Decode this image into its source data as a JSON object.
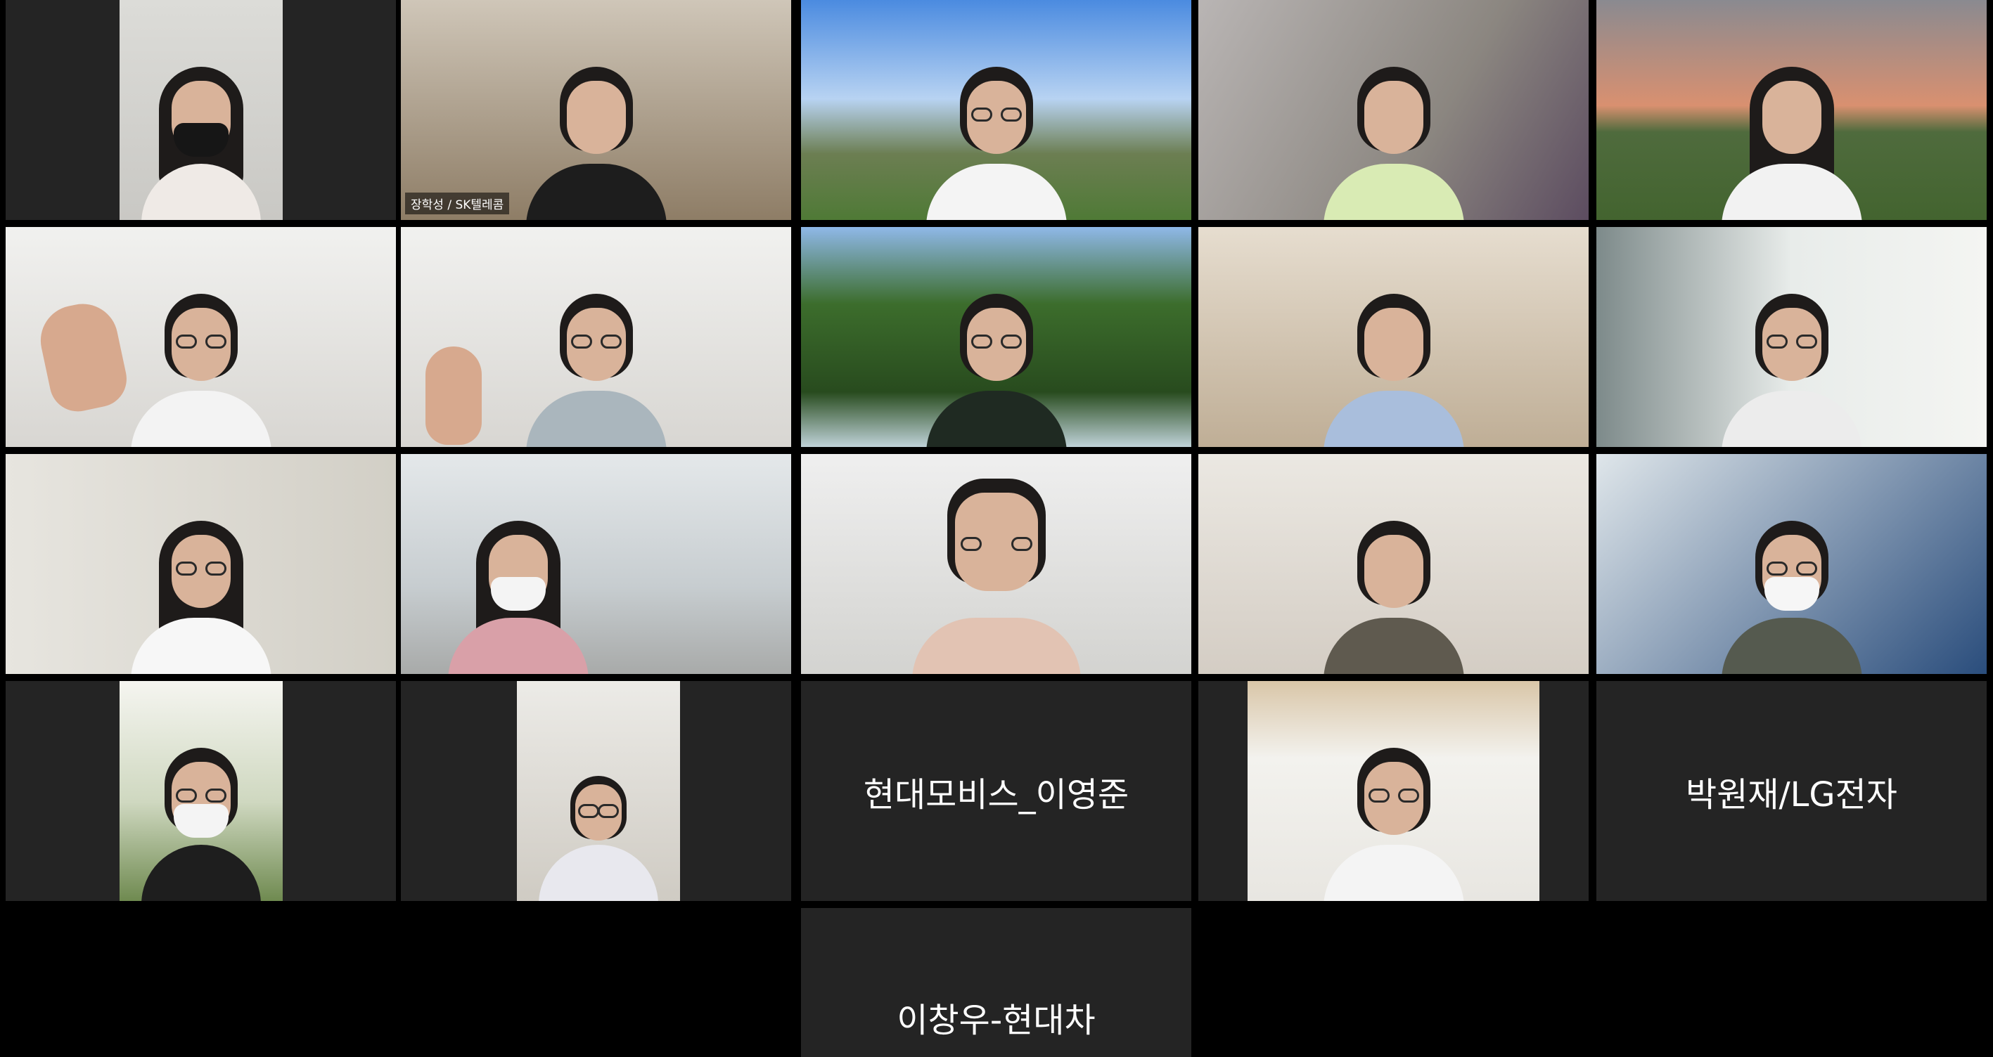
{
  "meeting": {
    "gallery": [
      {
        "id": "p1",
        "name_label": "",
        "bg": "bg-office",
        "framing": "narrow",
        "body": "#efeae6",
        "hair": "long",
        "glasses": false,
        "mask": "#161616",
        "active": false
      },
      {
        "id": "p2",
        "name_label": "장학성 / SK텔레콤",
        "bg": "bg-room",
        "framing": "full",
        "body": "#1d1d1d",
        "hair": "short",
        "glasses": false,
        "mask": "",
        "active": true
      },
      {
        "id": "p3",
        "name_label": "",
        "bg": "bg-sky",
        "framing": "full",
        "body": "#f4f4f4",
        "hair": "short",
        "glasses": true,
        "mask": "",
        "active": false
      },
      {
        "id": "p4",
        "name_label": "",
        "bg": "bg-blur",
        "framing": "full",
        "body": "#d9ebb4",
        "hair": "short",
        "glasses": false,
        "mask": "",
        "active": false
      },
      {
        "id": "p5",
        "name_label": "",
        "bg": "bg-sunset",
        "framing": "full",
        "body": "#f2f2f2",
        "hair": "long",
        "glasses": false,
        "mask": "",
        "active": false
      },
      {
        "id": "p6",
        "name_label": "",
        "bg": "bg-white",
        "framing": "full",
        "body": "#f3f3f3",
        "hair": "short",
        "glasses": true,
        "mask": "",
        "active": false,
        "hand": "left"
      },
      {
        "id": "p7",
        "name_label": "",
        "bg": "bg-white",
        "framing": "full",
        "body": "#aab6bd",
        "hair": "short",
        "glasses": true,
        "mask": "",
        "active": false,
        "hand": "left"
      },
      {
        "id": "p8",
        "name_label": "",
        "bg": "bg-forest",
        "framing": "full",
        "body": "#1f2a22",
        "hair": "short",
        "glasses": true,
        "mask": "",
        "active": false
      },
      {
        "id": "p9",
        "name_label": "",
        "bg": "bg-warm",
        "framing": "full",
        "body": "#a9bedc",
        "hair": "short",
        "glasses": false,
        "mask": "",
        "active": false
      },
      {
        "id": "p10",
        "name_label": "",
        "bg": "bg-window",
        "framing": "full",
        "body": "#ececec",
        "hair": "short",
        "glasses": true,
        "mask": "",
        "active": false
      },
      {
        "id": "p11",
        "name_label": "",
        "bg": "bg-yellow",
        "framing": "full",
        "body": "#f7f7f7",
        "hair": "long",
        "glasses": true,
        "mask": "",
        "active": false
      },
      {
        "id": "p12",
        "name_label": "",
        "bg": "bg-meeting",
        "framing": "full",
        "body": "#d9a0a8",
        "hair": "long",
        "glasses": false,
        "mask": "#f4f4f4",
        "active": false
      },
      {
        "id": "p13",
        "name_label": "",
        "bg": "bg-ceiling",
        "framing": "full",
        "body": "#e2c3b3",
        "hair": "short",
        "glasses": true,
        "mask": "",
        "active": false
      },
      {
        "id": "p14",
        "name_label": "",
        "bg": "bg-shelf",
        "framing": "full",
        "body": "#5f5a4f",
        "hair": "short",
        "glasses": false,
        "mask": "",
        "active": false
      },
      {
        "id": "p15",
        "name_label": "",
        "bg": "bg-blue",
        "framing": "full",
        "body": "#555a4f",
        "hair": "short",
        "glasses": true,
        "mask": "#f6f6f6",
        "active": false
      },
      {
        "id": "p16",
        "name_label": "",
        "bg": "bg-trees",
        "framing": "narrow",
        "body": "#1e1e1e",
        "hair": "short",
        "glasses": true,
        "mask": "#f4f4f4",
        "active": false
      },
      {
        "id": "p17",
        "name_label": "",
        "bg": "bg-hall",
        "framing": "narrow",
        "body": "#e8e8ee",
        "hair": "short",
        "glasses": true,
        "mask": "",
        "active": false
      },
      {
        "id": "p18",
        "name_label": "현대모비스_이영준",
        "framing": "none",
        "active": false
      },
      {
        "id": "p19",
        "name_label": "",
        "bg": "bg-cabinet",
        "framing": "wide",
        "body": "#f4f4f4",
        "hair": "short",
        "glasses": true,
        "mask": "",
        "active": false
      },
      {
        "id": "p20",
        "name_label": "박원재/LG전자",
        "framing": "none",
        "active": false
      },
      {
        "id": "p21",
        "name_label": "이창우-현대차",
        "framing": "none",
        "active": false
      }
    ]
  }
}
